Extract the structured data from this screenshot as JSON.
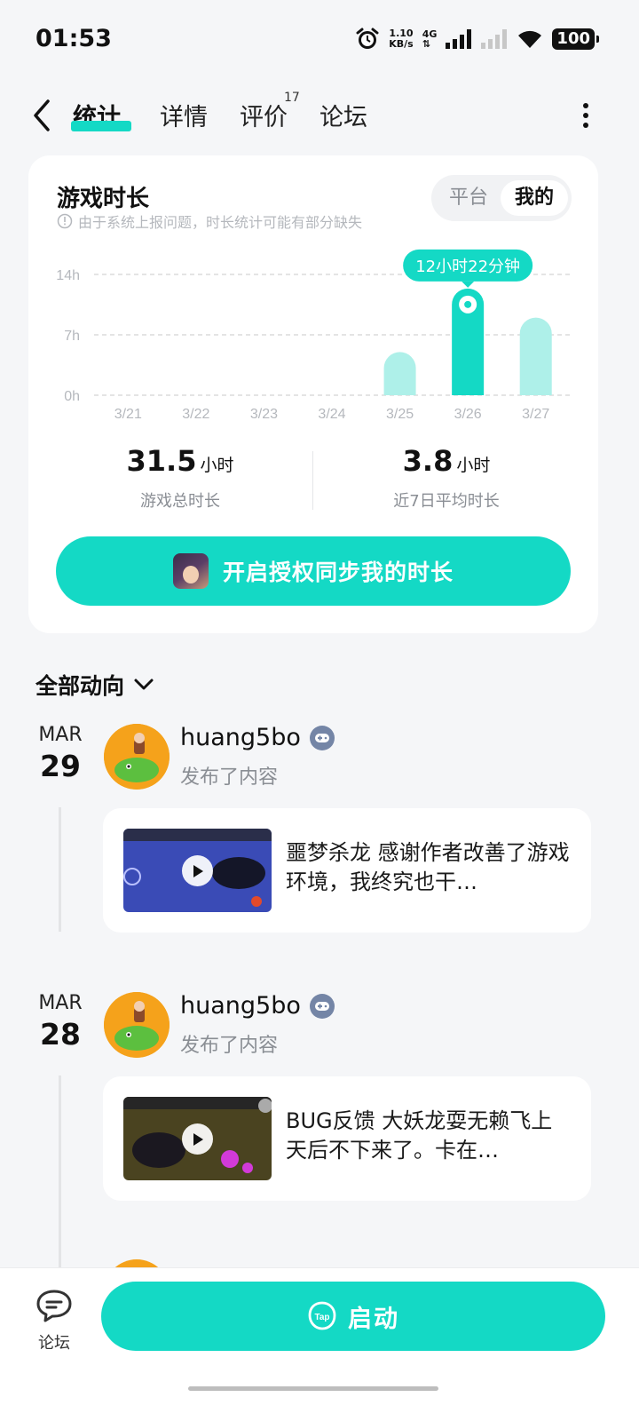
{
  "status_bar": {
    "time": "01:53",
    "net_speed_value": "1.10",
    "net_speed_unit": "KB/s",
    "network_type": "4G",
    "battery": "100"
  },
  "nav": {
    "tabs": [
      {
        "label": "统计",
        "active": true
      },
      {
        "label": "详情",
        "active": false
      },
      {
        "label": "评价",
        "active": false,
        "badge": "17"
      },
      {
        "label": "论坛",
        "active": false
      }
    ]
  },
  "playtime_card": {
    "title": "游戏时长",
    "note": "由于系统上报问题，时长统计可能有部分缺失",
    "toggle": {
      "platform": "平台",
      "mine": "我的",
      "selected": "我的"
    },
    "chart_data": {
      "type": "bar",
      "categories": [
        "3/21",
        "3/22",
        "3/23",
        "3/24",
        "3/25",
        "3/26",
        "3/27"
      ],
      "values": [
        0,
        0,
        0,
        0,
        5.0,
        12.37,
        9.0
      ],
      "unit": "h",
      "ylim": [
        0,
        14
      ],
      "yticks": [
        "0h",
        "7h",
        "14h"
      ],
      "ytick_values": [
        0,
        7,
        14
      ],
      "highlight_index": 5,
      "tooltip": "12小时22分钟",
      "colors": {
        "highlight": "#14d9c5",
        "normal": "#aef0e9",
        "grid": "#dcdcdc"
      }
    },
    "stats": [
      {
        "value": "31.5",
        "unit": "小时",
        "label": "游戏总时长"
      },
      {
        "value": "3.8",
        "unit": "小时",
        "label": "近7日平均时长"
      }
    ],
    "sync_button": "开启授权同步我的时长"
  },
  "feed": {
    "filter_label": "全部动向",
    "entries": [
      {
        "month": "MAR",
        "day": "29",
        "user": "huang5bo",
        "action": "发布了内容",
        "text": "噩梦杀龙 感谢作者改善了游戏环境，我终究也干…"
      },
      {
        "month": "MAR",
        "day": "28",
        "user": "huang5bo",
        "action": "发布了内容",
        "text": "BUG反馈 大妖龙耍无赖飞上天后不下来了。卡在…"
      }
    ]
  },
  "bottom": {
    "forum_label": "论坛",
    "launch_label": "启动",
    "launch_icon_text": "Tap"
  },
  "colors": {
    "accent": "#14d9c5",
    "background": "#f5f6f8"
  }
}
